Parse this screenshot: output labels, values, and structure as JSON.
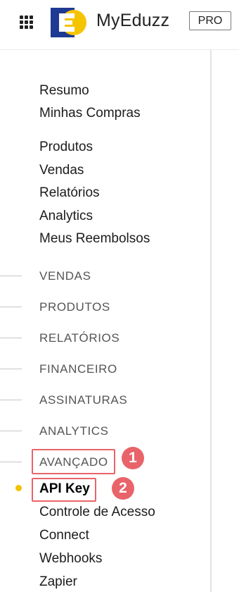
{
  "header": {
    "brand": "MyEduzz",
    "pro_label": "PRO",
    "logo_colors": {
      "square": "#1f3a93",
      "circle": "#f5c400"
    }
  },
  "menu": {
    "top_links": [
      "Resumo",
      "Minhas Compras"
    ],
    "main_links": [
      "Produtos",
      "Vendas",
      "Relatórios",
      "Analytics",
      "Meus Reembolsos"
    ],
    "sections": [
      "VENDAS",
      "PRODUTOS",
      "RELATÓRIOS",
      "FINANCEIRO",
      "ASSINATURAS",
      "ANALYTICS",
      "AVANÇADO"
    ],
    "advanced_items": [
      "API Key",
      "Controle de Acesso",
      "Connect",
      "Webhooks",
      "Zapier"
    ],
    "active_item": "API Key"
  },
  "annotations": {
    "badge_1": "1",
    "badge_2": "2",
    "highlight_color": "#e8646a"
  },
  "active_dot_color": "#f2c200"
}
